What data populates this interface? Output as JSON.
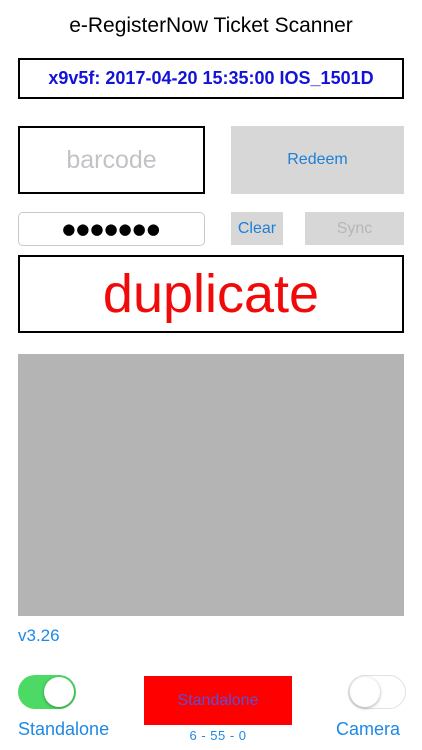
{
  "header": {
    "title": "e-RegisterNow Ticket Scanner"
  },
  "session": {
    "text": "x9v5f: 2017-04-20 15:35:00 IOS_1501D"
  },
  "scan": {
    "barcode_placeholder": "barcode",
    "redeem_label": "Redeem",
    "password_mask": "●●●●●●●",
    "clear_label": "Clear",
    "sync_label": "Sync"
  },
  "result": {
    "status_text": "duplicate",
    "status_color": "#f00a0a"
  },
  "footer": {
    "version": "v3.26",
    "standalone_label": "Standalone",
    "standalone_on": true,
    "mode_button_label": "Standalone",
    "stats": "6 - 55 - 0",
    "camera_label": "Camera",
    "camera_on": false
  },
  "colors": {
    "accent": "#1e88e5",
    "session_text": "#1212d8",
    "toggle_on": "#4cd964",
    "mode_button_bg": "#ff0000",
    "button_gray": "#d7d7d7",
    "preview_gray": "#b4b4b4"
  }
}
